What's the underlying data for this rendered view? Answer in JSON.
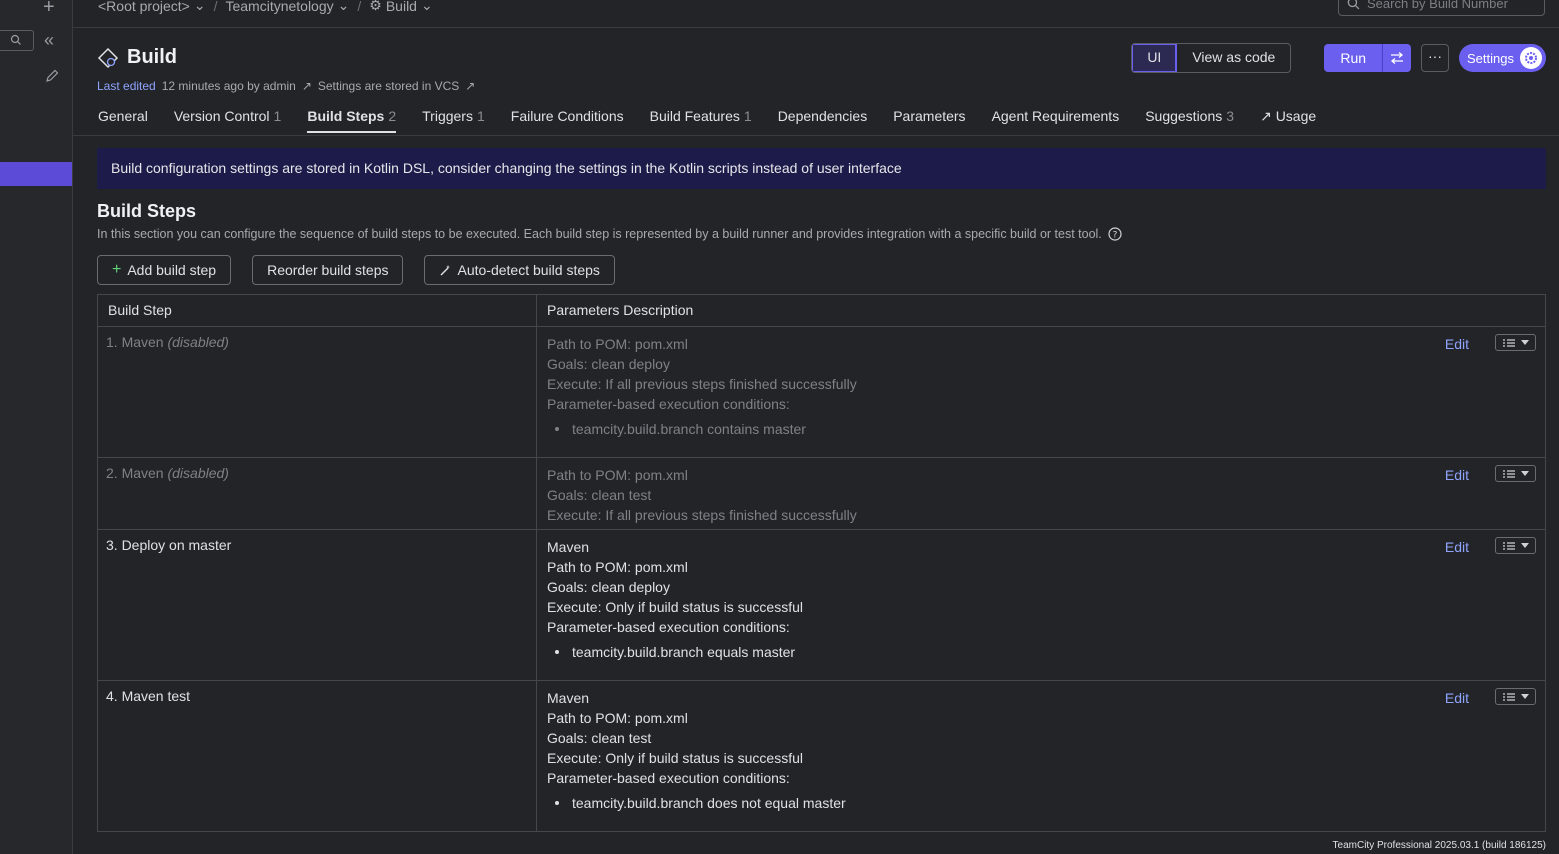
{
  "breadcrumb": {
    "items": [
      "<Root project>",
      "Teamcitynetology",
      "Build"
    ],
    "separator": "/"
  },
  "search": {
    "placeholder": "Search by Build Number"
  },
  "header": {
    "title": "Build",
    "last_edited_label": "Last edited",
    "last_edited_value": "12 minutes ago by admin",
    "settings_stored": "Settings are stored in VCS"
  },
  "view_toggle": {
    "ui": "UI",
    "code": "View as code"
  },
  "actions": {
    "run": "Run",
    "more": "···",
    "settings": "Settings"
  },
  "tabs": [
    {
      "label": "General",
      "count": ""
    },
    {
      "label": "Version Control",
      "count": "1"
    },
    {
      "label": "Build Steps",
      "count": "2"
    },
    {
      "label": "Triggers",
      "count": "1"
    },
    {
      "label": "Failure Conditions",
      "count": ""
    },
    {
      "label": "Build Features",
      "count": "1"
    },
    {
      "label": "Dependencies",
      "count": ""
    },
    {
      "label": "Parameters",
      "count": ""
    },
    {
      "label": "Agent Requirements",
      "count": ""
    },
    {
      "label": "Suggestions",
      "count": "3"
    },
    {
      "label": "Usage",
      "count": ""
    }
  ],
  "banner": "Build configuration settings are stored in Kotlin DSL, consider changing the settings in the Kotlin scripts instead of user interface",
  "section": {
    "title": "Build Steps",
    "description": "In this section you can configure the sequence of build steps to be executed. Each build step is represented by a build runner and provides integration with a specific build or test tool."
  },
  "buttons": {
    "add": "Add build step",
    "reorder": "Reorder build steps",
    "autodetect": "Auto-detect build steps"
  },
  "table": {
    "col1": "Build Step",
    "col2": "Parameters Description",
    "edit": "Edit",
    "rows": [
      {
        "name": "1. Maven ",
        "status": "(disabled)",
        "runner": "",
        "lines": [
          "Path to POM: pom.xml",
          "Goals: clean deploy",
          "Execute: If all previous steps finished successfully",
          "Parameter-based execution conditions:"
        ],
        "condition": "teamcity.build.branch contains master"
      },
      {
        "name": "2. Maven ",
        "status": "(disabled)",
        "runner": "",
        "lines": [
          "Path to POM: pom.xml",
          "Goals: clean test",
          "Execute: If all previous steps finished successfully"
        ],
        "condition": ""
      },
      {
        "name": "3. Deploy on master",
        "status": "",
        "runner": "Maven",
        "lines": [
          "Path to POM: pom.xml",
          "Goals: clean deploy",
          "Execute: Only if build status is successful",
          "Parameter-based execution conditions:"
        ],
        "condition": "teamcity.build.branch equals master"
      },
      {
        "name": "4. Maven test",
        "status": "",
        "runner": "Maven",
        "lines": [
          "Path to POM: pom.xml",
          "Goals: clean test",
          "Execute: Only if build status is successful",
          "Parameter-based execution conditions:"
        ],
        "condition": "teamcity.build.branch does not equal master"
      }
    ]
  },
  "footer": "TeamCity Professional 2025.03.1 (build 186125)",
  "colors": {
    "accent": "#6b5ff0",
    "link": "#8fa4ff",
    "banner": "#1d1b4a",
    "background": "#232427"
  }
}
